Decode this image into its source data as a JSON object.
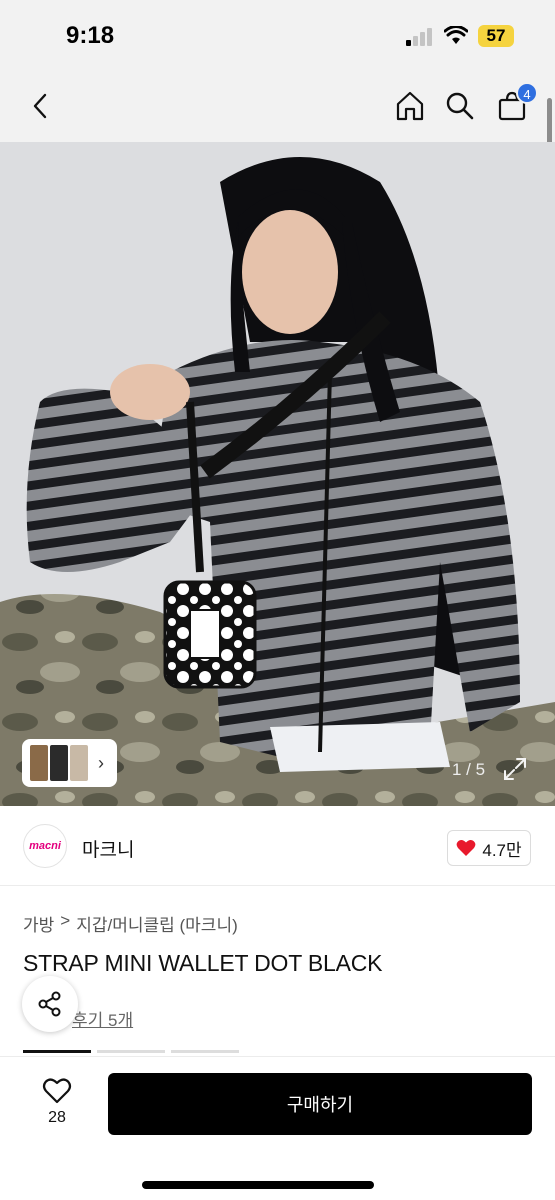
{
  "status_bar": {
    "time": "9:18",
    "battery": "57"
  },
  "nav": {
    "cart_count": "4"
  },
  "gallery": {
    "page_indicator": "1 / 5"
  },
  "brand": {
    "logo_text": "macni",
    "name": "마크니",
    "likes": "4.7만"
  },
  "breadcrumb": {
    "level1": "가방",
    "separator": ">",
    "level2": "지갑/머니클립 (마크니)"
  },
  "product": {
    "title": "STRAP MINI WALLET DOT BLACK",
    "reviews_label": "후기 5개"
  },
  "bottom_bar": {
    "wish_count": "28",
    "buy_label": "구매하기"
  },
  "colors": {
    "accent": "#e4007f",
    "badge": "#2f6fe0",
    "buy_button": "#000000",
    "heart": "#e8192c"
  }
}
